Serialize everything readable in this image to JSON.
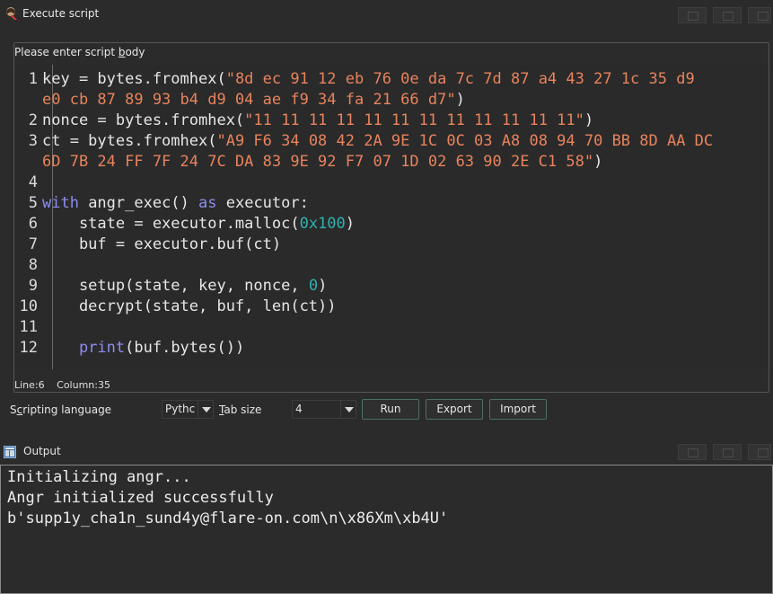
{
  "window": {
    "title": "Execute script"
  },
  "script_group": {
    "label_prefix": "Please enter script ",
    "label_accel": "b",
    "label_suffix": "ody"
  },
  "editor": {
    "lines": [
      {
        "n": "1",
        "tokens": [
          {
            "t": "key = bytes.fromhex(",
            "c": ""
          },
          {
            "t": "\"8d ec 91 12 eb 76 0e da 7c 7d 87 a4 43 27 1c 35 d9",
            "c": "s"
          }
        ]
      },
      {
        "n": "",
        "tokens": [
          {
            "t": "e0 cb 87 89 93 b4 d9 04 ae f9 34 fa 21 66 d7\"",
            "c": "s"
          },
          {
            "t": ")",
            "c": ""
          }
        ]
      },
      {
        "n": "2",
        "tokens": [
          {
            "t": "nonce = bytes.fromhex(",
            "c": ""
          },
          {
            "t": "\"11 11 11 11 11 11 11 11 11 11 11 11\"",
            "c": "s"
          },
          {
            "t": ")",
            "c": ""
          }
        ]
      },
      {
        "n": "3",
        "tokens": [
          {
            "t": "ct = bytes.fromhex(",
            "c": ""
          },
          {
            "t": "\"A9 F6 34 08 42 2A 9E 1C 0C 03 A8 08 94 70 BB 8D AA DC",
            "c": "s"
          }
        ]
      },
      {
        "n": "",
        "tokens": [
          {
            "t": "6D 7B 24 FF 7F 24 7C DA 83 9E 92 F7 07 1D 02 63 90 2E C1 58\"",
            "c": "s"
          },
          {
            "t": ")",
            "c": ""
          }
        ]
      },
      {
        "n": "4",
        "tokens": []
      },
      {
        "n": "5",
        "tokens": [
          {
            "t": "with",
            "c": "k"
          },
          {
            "t": " angr_exec() ",
            "c": ""
          },
          {
            "t": "as",
            "c": "k"
          },
          {
            "t": " executor:",
            "c": ""
          }
        ]
      },
      {
        "n": "6",
        "tokens": [
          {
            "t": "    state = executor.malloc(",
            "c": ""
          },
          {
            "t": "0x100",
            "c": "n"
          },
          {
            "t": ")",
            "c": ""
          }
        ]
      },
      {
        "n": "7",
        "tokens": [
          {
            "t": "    buf = executor.buf(ct)",
            "c": ""
          }
        ]
      },
      {
        "n": "8",
        "tokens": []
      },
      {
        "n": "9",
        "tokens": [
          {
            "t": "    setup(state, key, nonce, ",
            "c": ""
          },
          {
            "t": "0",
            "c": "n"
          },
          {
            "t": ")",
            "c": ""
          }
        ]
      },
      {
        "n": "10",
        "tokens": [
          {
            "t": "    decrypt(state, buf, len(ct))",
            "c": ""
          }
        ]
      },
      {
        "n": "11",
        "tokens": []
      },
      {
        "n": "12",
        "tokens": [
          {
            "t": "    ",
            "c": ""
          },
          {
            "t": "print",
            "c": "f"
          },
          {
            "t": "(buf.bytes())",
            "c": ""
          }
        ]
      }
    ]
  },
  "status": {
    "line": "Line:6",
    "column": "Column:35"
  },
  "controls": {
    "language_label": "Scripting language",
    "language_value": "Pythc",
    "tabsize_label": "Tab size",
    "tabsize_value": "4",
    "run_label": "Run",
    "export_label": "Export",
    "import_label": "Import"
  },
  "output": {
    "title": "Output",
    "lines": [
      "Initializing angr...",
      "Angr initialized successfully",
      "b'supp1y_cha1n_sund4y@flare-on.com\\n\\x86Xm\\xb4U'"
    ]
  },
  "colors": {
    "string": "#e8835c",
    "keyword": "#8d8df2",
    "number": "#2fb1b1",
    "accent_border": "#4a6f68"
  }
}
